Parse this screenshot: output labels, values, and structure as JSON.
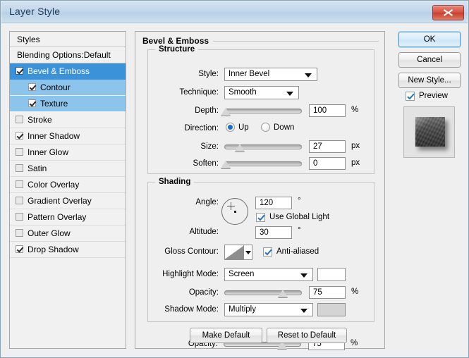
{
  "window": {
    "title": "Layer Style",
    "close_icon": "close-icon"
  },
  "styles_panel": {
    "header": "Styles",
    "blending_options": "Blending Options:Default",
    "effects": [
      {
        "label": "Bevel & Emboss",
        "checked": true,
        "indent": false,
        "selection": "strong"
      },
      {
        "label": "Contour",
        "checked": true,
        "indent": true,
        "selection": "light"
      },
      {
        "label": "Texture",
        "checked": true,
        "indent": true,
        "selection": "light"
      },
      {
        "label": "Stroke",
        "checked": false,
        "indent": false,
        "selection": "none"
      },
      {
        "label": "Inner Shadow",
        "checked": true,
        "indent": false,
        "selection": "none"
      },
      {
        "label": "Inner Glow",
        "checked": false,
        "indent": false,
        "selection": "none"
      },
      {
        "label": "Satin",
        "checked": false,
        "indent": false,
        "selection": "none"
      },
      {
        "label": "Color Overlay",
        "checked": false,
        "indent": false,
        "selection": "none"
      },
      {
        "label": "Gradient Overlay",
        "checked": false,
        "indent": false,
        "selection": "none"
      },
      {
        "label": "Pattern Overlay",
        "checked": false,
        "indent": false,
        "selection": "none"
      },
      {
        "label": "Outer Glow",
        "checked": false,
        "indent": false,
        "selection": "none"
      },
      {
        "label": "Drop Shadow",
        "checked": true,
        "indent": false,
        "selection": "none"
      }
    ]
  },
  "main": {
    "title": "Bevel & Emboss",
    "structure": {
      "legend": "Structure",
      "style_label": "Style:",
      "style_value": "Inner Bevel",
      "technique_label": "Technique:",
      "technique_value": "Smooth",
      "depth_label": "Depth:",
      "depth_value": "100",
      "depth_unit": "%",
      "depth_pct": 2,
      "direction_label": "Direction:",
      "direction_up": "Up",
      "direction_down": "Down",
      "direction_selected": "Up",
      "size_label": "Size:",
      "size_value": "27",
      "size_unit": "px",
      "size_pct": 20,
      "soften_label": "Soften:",
      "soften_value": "0",
      "soften_unit": "px",
      "soften_pct": 2
    },
    "shading": {
      "legend": "Shading",
      "angle_label": "Angle:",
      "angle_value": "120",
      "angle_unit": "°",
      "use_global_light": "Use Global Light",
      "use_global_light_checked": true,
      "altitude_label": "Altitude:",
      "altitude_value": "30",
      "altitude_unit": "°",
      "gloss_contour_label": "Gloss Contour:",
      "anti_aliased": "Anti-aliased",
      "anti_aliased_checked": true,
      "highlight_mode_label": "Highlight Mode:",
      "highlight_mode_value": "Screen",
      "highlight_color": "#ffffff",
      "highlight_opacity_label": "Opacity:",
      "highlight_opacity_value": "75",
      "highlight_opacity_unit": "%",
      "highlight_opacity_pct": 75,
      "shadow_mode_label": "Shadow Mode:",
      "shadow_mode_value": "Multiply",
      "shadow_color": "#d4d4d4",
      "shadow_opacity_label": "Opacity:",
      "shadow_opacity_value": "75",
      "shadow_opacity_unit": "%",
      "shadow_opacity_pct": 75
    },
    "make_default": "Make Default",
    "reset_to_default": "Reset to Default"
  },
  "side_buttons": {
    "ok": "OK",
    "cancel": "Cancel",
    "new_style": "New Style...",
    "preview_label": "Preview",
    "preview_checked": true
  }
}
